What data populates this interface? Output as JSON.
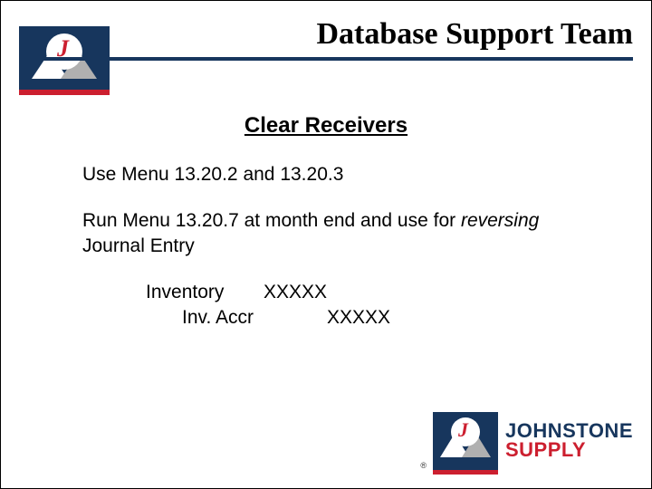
{
  "header": {
    "title": "Database Support Team"
  },
  "brand": {
    "name_line1": "JOHNSTONE",
    "name_line2": "SUPPLY",
    "letter": "J",
    "registered": "®"
  },
  "subtitle": "Clear Receivers",
  "body": {
    "line1": "Use Menu 13.20.2 and 13.20.3",
    "line2_a": "Run Menu 13.20.7 at month end and use for ",
    "line2_em": "reversing",
    "line2_b": " Journal Entry"
  },
  "je": {
    "row1_label": "Inventory",
    "row1_amount": "XXXXX",
    "row2_label": "Inv. Accr",
    "row2_amount": "XXXXX"
  }
}
